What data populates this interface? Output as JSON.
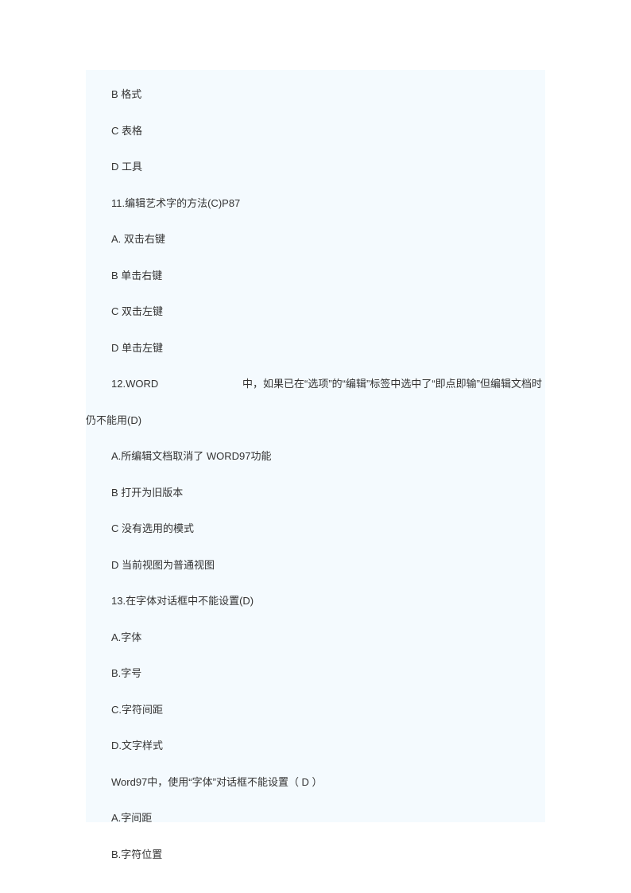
{
  "lines": [
    {
      "type": "indent",
      "text": "B  格式"
    },
    {
      "type": "indent",
      "text": "C  表格"
    },
    {
      "type": "indent",
      "text": "D  工具"
    },
    {
      "type": "indent",
      "text": "11.编辑艺术字的方法(C)P87"
    },
    {
      "type": "indent",
      "text": "A.  双击右键"
    },
    {
      "type": "indent",
      "text": "B  单击右键"
    },
    {
      "type": "indent",
      "text": "C  双击左键"
    },
    {
      "type": "indent",
      "text": "D  单击左键"
    },
    {
      "type": "justified",
      "segments": [
        "12.WORD",
        "中，如果已在“选项”的“编辑”标签中选中了“即点即输”但编辑文档时"
      ]
    },
    {
      "type": "noindent",
      "text": "仍不能用(D)"
    },
    {
      "type": "indent",
      "text": "A.所编辑文档取消了 WORD97功能"
    },
    {
      "type": "indent",
      "text": "B  打开为旧版本"
    },
    {
      "type": "indent",
      "text": "C  没有选用的模式"
    },
    {
      "type": "indent",
      "text": "D  当前视图为普通视图"
    },
    {
      "type": "indent",
      "text": "13.在字体对话框中不能设置(D)"
    },
    {
      "type": "indent",
      "text": "A.字体"
    },
    {
      "type": "indent",
      "text": "B.字号"
    },
    {
      "type": "indent",
      "text": "C.字符间距"
    },
    {
      "type": "indent",
      "text": "D.文字样式"
    },
    {
      "type": "indent",
      "text": "Word97中，使用“字体”对话框不能设置（ D ）"
    },
    {
      "type": "indent",
      "text": "A.字间距"
    },
    {
      "type": "indent",
      "text": "B.字符位置"
    }
  ]
}
